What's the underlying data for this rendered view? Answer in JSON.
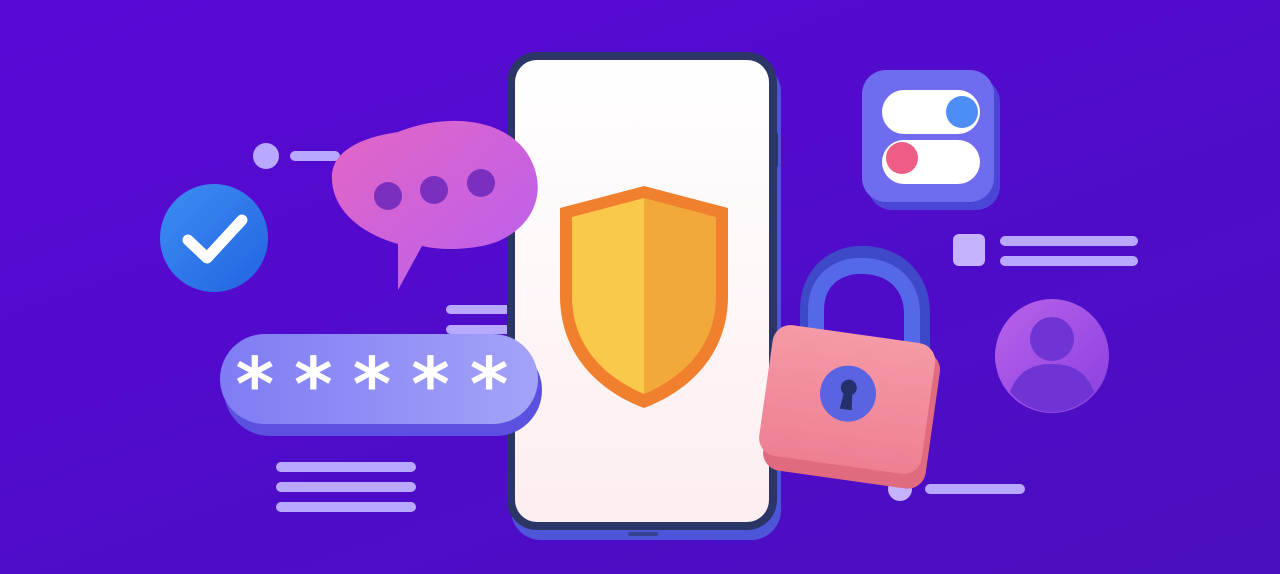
{
  "illustration": {
    "password_mask": "*****",
    "colors": {
      "background": "#5309d3",
      "phone_frame": "#2b3566",
      "phone_screen": "#fdf1f2",
      "shield_light": "#fbc94a",
      "shield_dark": "#f2a93a",
      "shield_outline": "#f07f2e",
      "check_badge": "#2f78ec",
      "chat_bubble": "#d55cc9",
      "password_field": "#8e8cf2",
      "padlock_body": "#f28a9a",
      "padlock_shackle": "#4f5fe6",
      "toggle_card": "#6f6cf0",
      "avatar": "#a851e6",
      "lines": "#b6a4ff"
    },
    "icons": [
      "check-icon",
      "chat-icon",
      "shield-icon",
      "padlock-icon",
      "toggle-icon",
      "user-icon",
      "password-field"
    ]
  }
}
